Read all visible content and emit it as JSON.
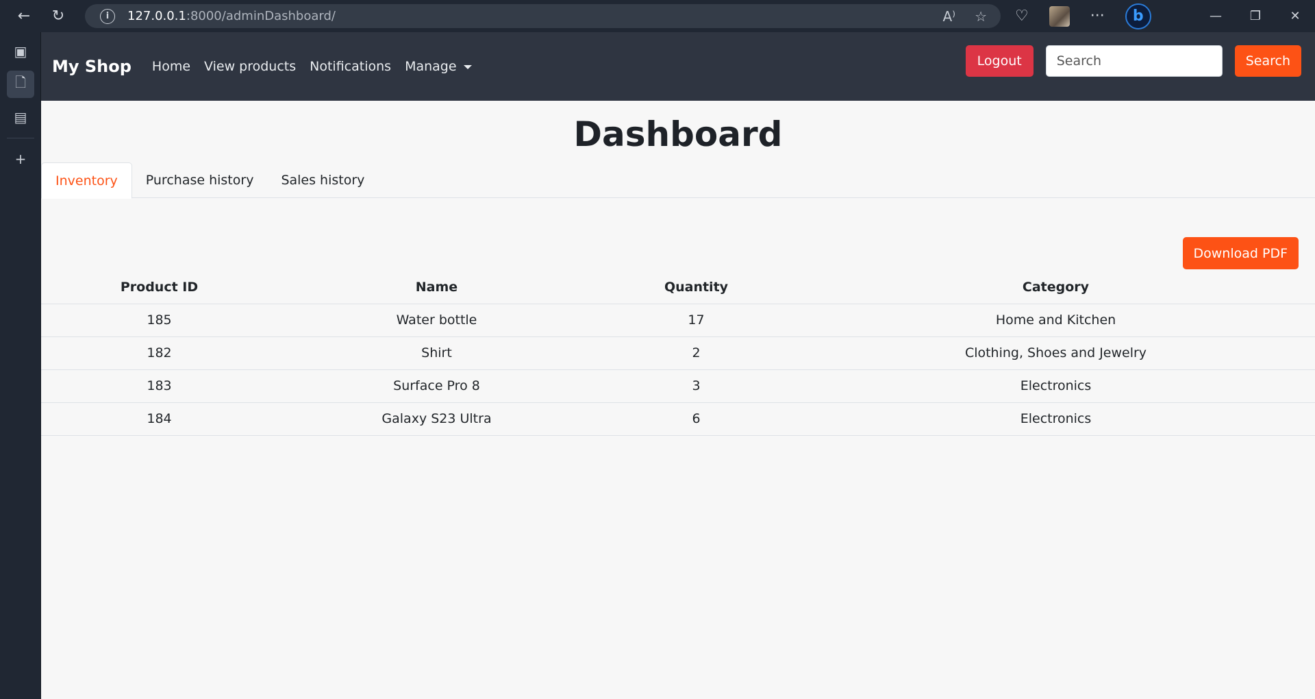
{
  "browser": {
    "url_host": "127.0.0.1",
    "url_path": ":8000/adminDashboard/"
  },
  "navbar": {
    "brand": "My Shop",
    "links": [
      "Home",
      "View products",
      "Notifications",
      "Manage"
    ],
    "logout_label": "Logout",
    "search_placeholder": "Search",
    "search_label": "Search"
  },
  "page": {
    "title": "Dashboard",
    "tabs": [
      "Inventory",
      "Purchase history",
      "Sales history"
    ],
    "active_tab": "Inventory",
    "download_label": "Download PDF"
  },
  "table": {
    "headers": [
      "Product ID",
      "Name",
      "Quantity",
      "Category"
    ],
    "rows": [
      [
        "185",
        "Water bottle",
        "17",
        "Home and Kitchen"
      ],
      [
        "182",
        "Shirt",
        "2",
        "Clothing, Shoes and Jewelry"
      ],
      [
        "183",
        "Surface Pro 8",
        "3",
        "Electronics"
      ],
      [
        "184",
        "Galaxy S23 Ultra",
        "6",
        "Electronics"
      ]
    ]
  },
  "colors": {
    "accent": "#fd5215",
    "danger": "#dc3545",
    "navbar": "#2f3541",
    "chrome": "#202733"
  }
}
